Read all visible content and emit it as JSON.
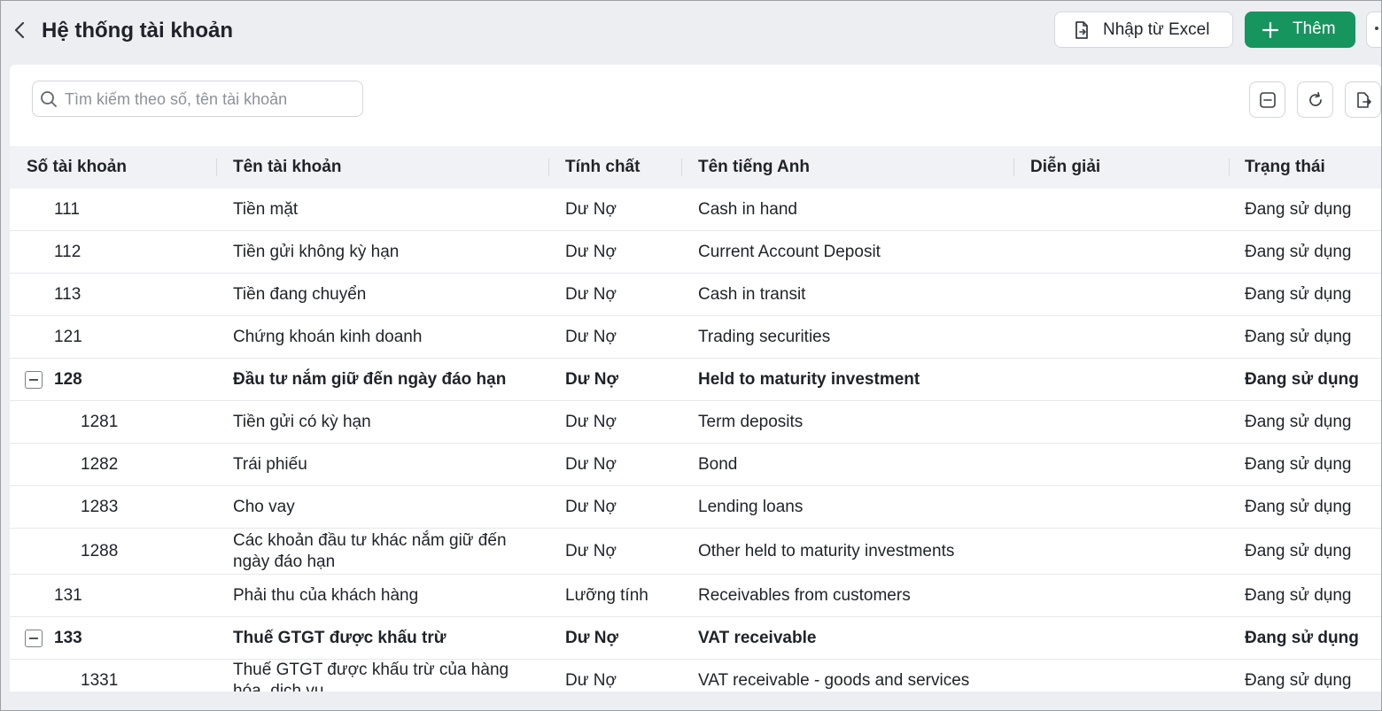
{
  "header": {
    "title": "Hệ thống tài khoản",
    "import_label": "Nhập từ Excel",
    "add_label": "Thêm"
  },
  "toolbar": {
    "search_placeholder": "Tìm kiếm theo số, tên tài khoản",
    "search_value": ""
  },
  "table": {
    "columns": [
      "Số tài khoản",
      "Tên tài khoản",
      "Tính chất",
      "Tên tiếng Anh",
      "Diễn giải",
      "Trạng thái"
    ],
    "rows": [
      {
        "code": "111",
        "name": "Tiền mặt",
        "nature": "Dư Nợ",
        "english": "Cash in hand",
        "description": "",
        "status": "Đang sử dụng",
        "level": 1,
        "bold": false,
        "expandable": false
      },
      {
        "code": "112",
        "name": "Tiền gửi không kỳ hạn",
        "nature": "Dư Nợ",
        "english": "Current Account Deposit",
        "description": "",
        "status": "Đang sử dụng",
        "level": 1,
        "bold": false,
        "expandable": false
      },
      {
        "code": "113",
        "name": "Tiền đang chuyển",
        "nature": "Dư Nợ",
        "english": "Cash in transit",
        "description": "",
        "status": "Đang sử dụng",
        "level": 1,
        "bold": false,
        "expandable": false
      },
      {
        "code": "121",
        "name": "Chứng khoán kinh doanh",
        "nature": "Dư Nợ",
        "english": "Trading securities",
        "description": "",
        "status": "Đang sử dụng",
        "level": 1,
        "bold": false,
        "expandable": false
      },
      {
        "code": "128",
        "name": "Đầu tư nắm giữ đến ngày đáo hạn",
        "nature": "Dư Nợ",
        "english": "Held to maturity investment",
        "description": "",
        "status": "Đang sử dụng",
        "level": 1,
        "bold": true,
        "expandable": true
      },
      {
        "code": "1281",
        "name": "Tiền gửi có kỳ hạn",
        "nature": "Dư Nợ",
        "english": "Term deposits",
        "description": "",
        "status": "Đang sử dụng",
        "level": 2,
        "bold": false,
        "expandable": false
      },
      {
        "code": "1282",
        "name": "Trái phiếu",
        "nature": "Dư Nợ",
        "english": "Bond",
        "description": "",
        "status": "Đang sử dụng",
        "level": 2,
        "bold": false,
        "expandable": false
      },
      {
        "code": "1283",
        "name": "Cho vay",
        "nature": "Dư Nợ",
        "english": "Lending loans",
        "description": "",
        "status": "Đang sử dụng",
        "level": 2,
        "bold": false,
        "expandable": false
      },
      {
        "code": "1288",
        "name": "Các khoản đầu tư khác nắm giữ đến ngày đáo hạn",
        "nature": "Dư Nợ",
        "english": "Other held to maturity investments",
        "description": "",
        "status": "Đang sử dụng",
        "level": 2,
        "bold": false,
        "expandable": false
      },
      {
        "code": "131",
        "name": "Phải thu của khách hàng",
        "nature": "Lưỡng tính",
        "english": "Receivables from customers",
        "description": "",
        "status": "Đang sử dụng",
        "level": 1,
        "bold": false,
        "expandable": false
      },
      {
        "code": "133",
        "name": "Thuế GTGT được khấu trừ",
        "nature": "Dư Nợ",
        "english": "VAT receivable",
        "description": "",
        "status": "Đang sử dụng",
        "level": 1,
        "bold": true,
        "expandable": true
      },
      {
        "code": "1331",
        "name": "Thuế GTGT được khấu trừ của hàng hóa, dịch vụ",
        "nature": "Dư Nợ",
        "english": "VAT receivable - goods and services",
        "description": "",
        "status": "Đang sử dụng",
        "level": 2,
        "bold": false,
        "expandable": false
      }
    ]
  },
  "colors": {
    "accent": "#17955f",
    "background": "#eceef2",
    "header_row": "#f0f2f5"
  }
}
